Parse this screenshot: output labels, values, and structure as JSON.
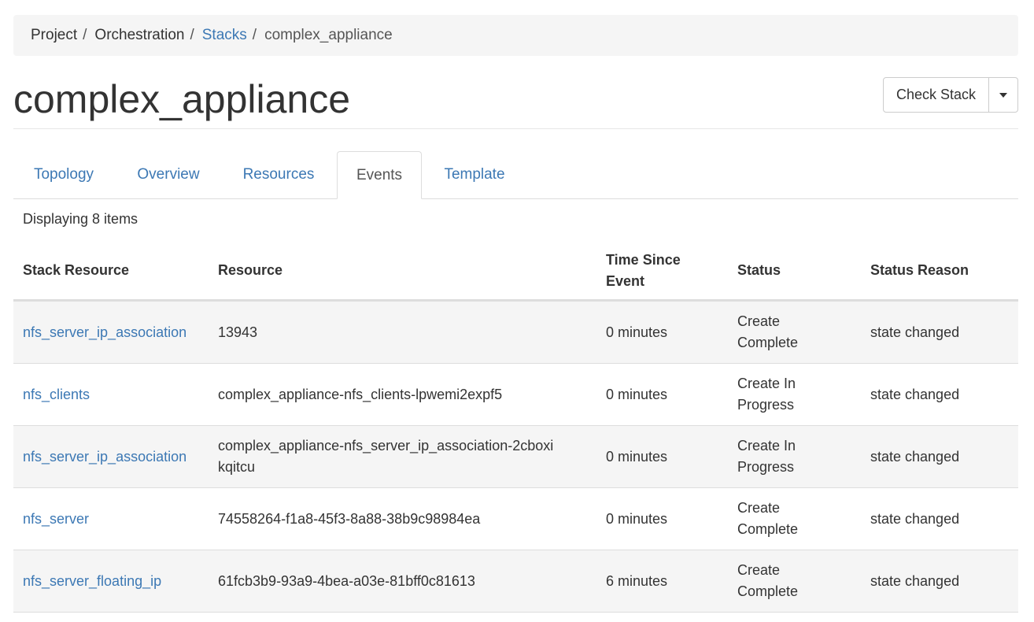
{
  "breadcrumb": {
    "items": [
      {
        "label": "Project"
      },
      {
        "label": "Orchestration"
      },
      {
        "label": "Stacks"
      },
      {
        "label": "complex_appliance"
      }
    ],
    "separator": "/"
  },
  "header": {
    "title": "complex_appliance",
    "action_label": "Check Stack"
  },
  "tabs": [
    {
      "label": "Topology"
    },
    {
      "label": "Overview"
    },
    {
      "label": "Resources"
    },
    {
      "label": "Events"
    },
    {
      "label": "Template"
    }
  ],
  "table": {
    "count_text": "Displaying 8 items",
    "columns": [
      "Stack Resource",
      "Resource",
      "Time Since Event",
      "Status",
      "Status Reason"
    ],
    "rows": [
      {
        "stack_resource": "nfs_server_ip_association",
        "resource": "13943",
        "time": "0 minutes",
        "status": "Create Complete",
        "reason": "state changed"
      },
      {
        "stack_resource": "nfs_clients",
        "resource": "complex_appliance-nfs_clients-lpwemi2expf5",
        "time": "0 minutes",
        "status": "Create In Progress",
        "reason": "state changed"
      },
      {
        "stack_resource": "nfs_server_ip_association",
        "resource": "complex_appliance-nfs_server_ip_association-2cboxikqitcu",
        "time": "0 minutes",
        "status": "Create In Progress",
        "reason": "state changed"
      },
      {
        "stack_resource": "nfs_server",
        "resource": "74558264-f1a8-45f3-8a88-38b9c98984ea",
        "time": "0 minutes",
        "status": "Create Complete",
        "reason": "state changed"
      },
      {
        "stack_resource": "nfs_server_floating_ip",
        "resource": "61fcb3b9-93a9-4bea-a03e-81bff0c81613",
        "time": "6 minutes",
        "status": "Create Complete",
        "reason": "state changed"
      }
    ]
  },
  "colors": {
    "link": "#3c78b4",
    "text": "#333333",
    "stripe": "#f5f5f5",
    "border": "#dddddd"
  }
}
